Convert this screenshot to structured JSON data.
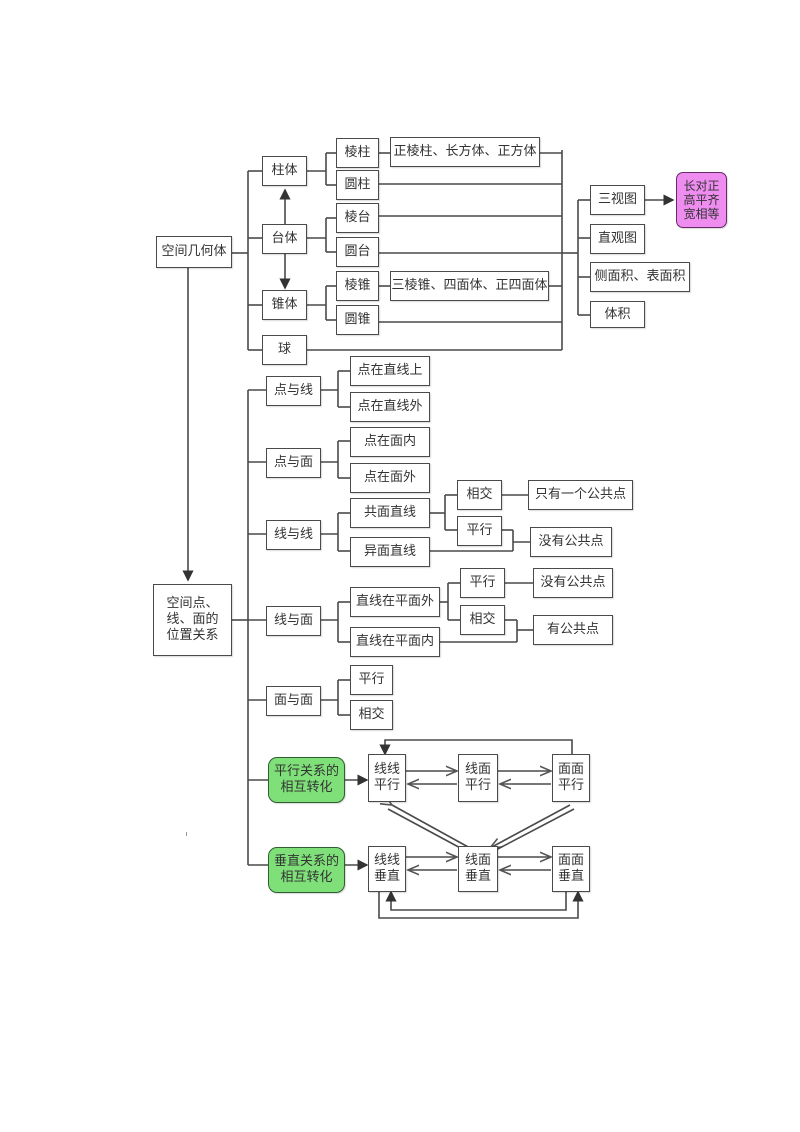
{
  "diagram": {
    "root1": "空间几何体",
    "solids": {
      "prism": "柱体",
      "frustum": "台体",
      "pyramid": "锥体",
      "sphere": "球",
      "regular_prism": "棱柱",
      "cylinder": "圆柱",
      "prism_examples": "正棱柱、长方体、正方体",
      "frustum_prism": "棱台",
      "frustum_round": "圆台",
      "pyramid_prism": "棱锥",
      "cone": "圆锥",
      "pyramid_examples": "三棱锥、四面体、正四面体"
    },
    "views": {
      "three_view": "三视图",
      "three_view_rule": "长对正\n高平齐\n宽相等",
      "intuitive_view": "直观图",
      "areas": "侧面积、表面积",
      "volume": "体积"
    },
    "root2": "空间点、\n线、面的\n位置关系",
    "relations": {
      "point_line": "点与线",
      "point_on_line": "点在直线上",
      "point_off_line": "点在直线外",
      "point_plane": "点与面",
      "point_in_plane": "点在面内",
      "point_out_plane": "点在面外",
      "line_line": "线与线",
      "coplanar": "共面直线",
      "skew": "异面直线",
      "ll_intersect": "相交",
      "ll_parallel": "平行",
      "one_common_point": "只有一个公共点",
      "no_common_point_1": "没有公共点",
      "line_plane": "线与面",
      "line_out_plane": "直线在平面外",
      "line_in_plane": "直线在平面内",
      "lp_parallel": "平行",
      "lp_intersect": "相交",
      "no_common_point_2": "没有公共点",
      "has_common_point": "有公共点",
      "plane_plane": "面与面",
      "pp_parallel": "平行",
      "pp_intersect": "相交"
    },
    "transform": {
      "parallel_title": "平行关系的\n相互转化",
      "perp_title": "垂直关系的\n相互转化",
      "ll_parallel": "线线\n平行",
      "lp_parallel": "线面\n平行",
      "pp_parallel": "面面\n平行",
      "ll_perp": "线线\n垂直",
      "lp_perp": "线面\n垂直",
      "pp_perp": "面面\n垂直"
    },
    "colors": {
      "green_box": "#7fe07a",
      "pink_box": "#ef8cf0",
      "line": "#4a4a4a"
    }
  }
}
